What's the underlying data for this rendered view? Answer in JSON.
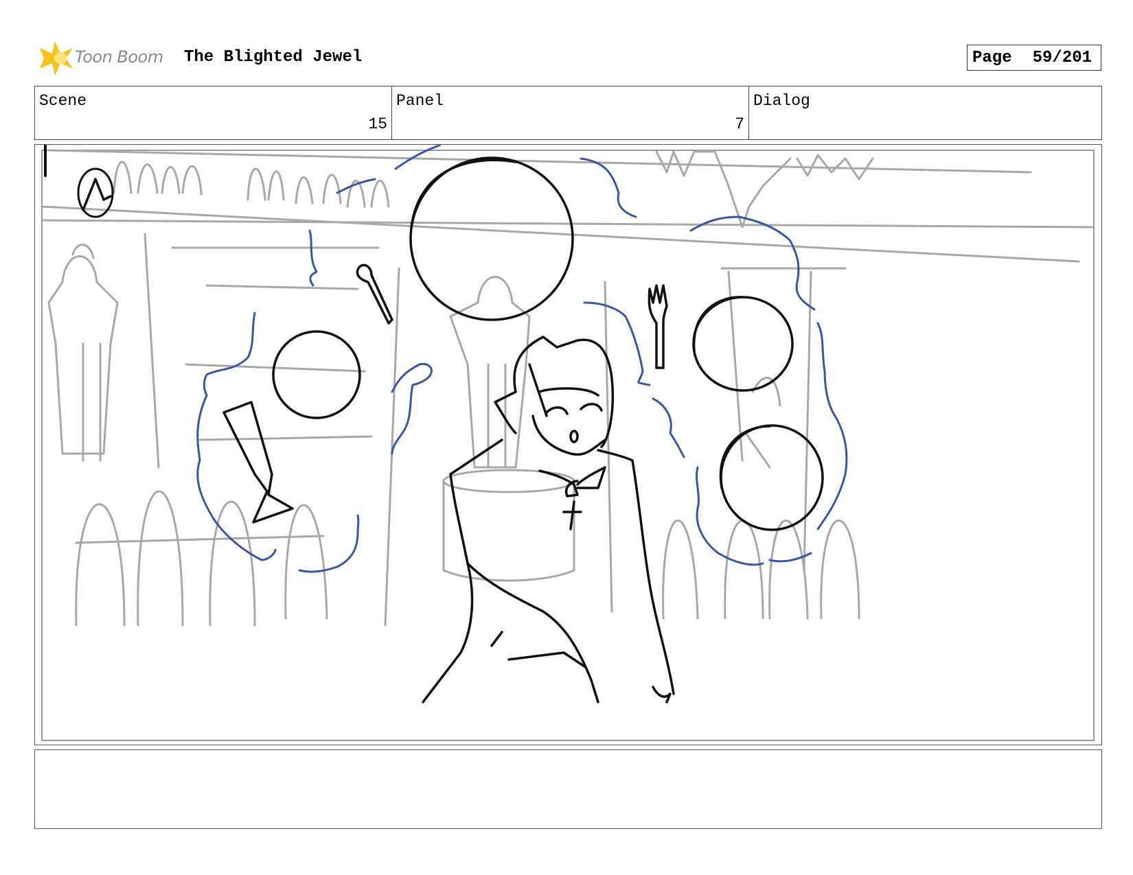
{
  "header": {
    "brand": "Toon Boom",
    "project_title": "The Blighted Jewel",
    "page_label": "Page",
    "page_number": "59/201"
  },
  "info": {
    "scene_label": "Scene",
    "scene_value": "15",
    "panel_label": "Panel",
    "panel_value": "7",
    "dialog_label": "Dialog",
    "dialog_value": ""
  },
  "notes": {
    "text": ""
  },
  "colors": {
    "sketch_black": "#111111",
    "sketch_grey": "#a8a8a8",
    "magic_blue": "#3a55a5",
    "logo_yellow": "#f6c21a"
  }
}
